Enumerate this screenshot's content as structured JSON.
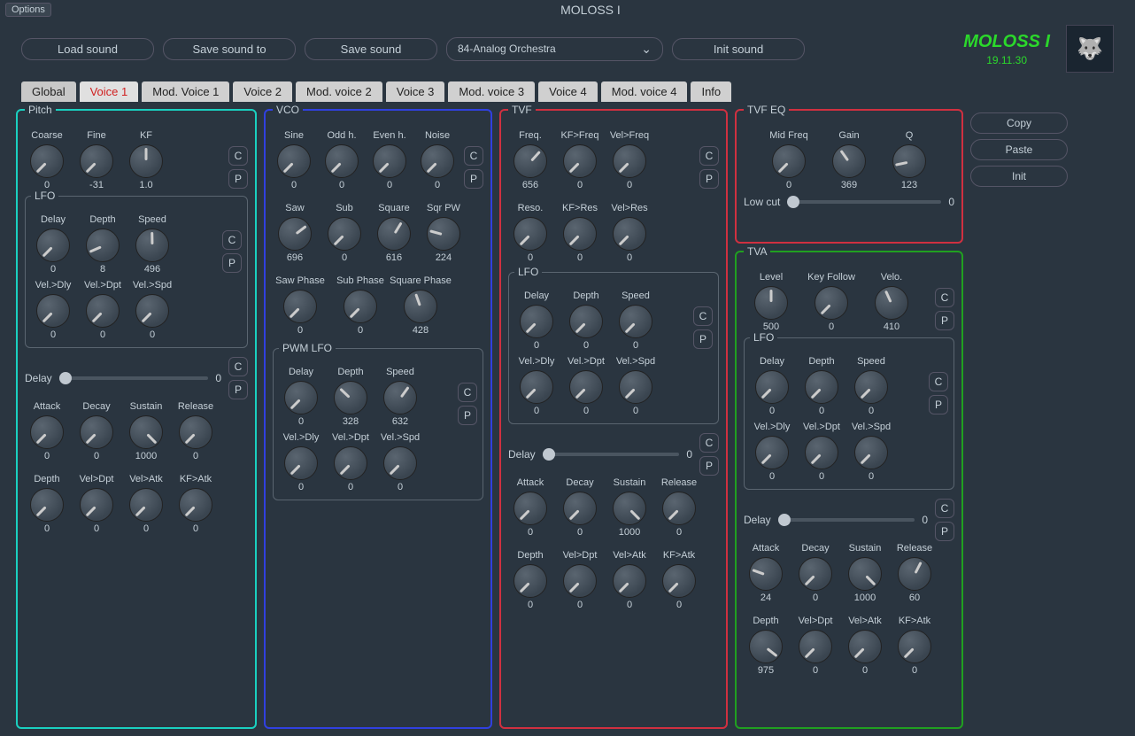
{
  "window": {
    "options": "Options",
    "title": "MOLOSS I"
  },
  "toolbar": {
    "load": "Load sound",
    "saveto": "Save sound to",
    "save": "Save sound",
    "preset": "84-Analog Orchestra",
    "init": "Init sound"
  },
  "brand": {
    "name": "MOLOSS I",
    "version": "19.11.30"
  },
  "tabs": [
    "Global",
    "Voice 1",
    "Mod. Voice 1",
    "Voice 2",
    "Mod. voice 2",
    "Voice 3",
    "Mod. voice 3",
    "Voice 4",
    "Mod. voice 4",
    "Info"
  ],
  "active_tab": 1,
  "side": {
    "copy": "Copy",
    "paste": "Paste",
    "init": "Init"
  },
  "cp": {
    "c": "C",
    "p": "P"
  },
  "pitch": {
    "title": "Pitch",
    "top": [
      {
        "l": "Coarse",
        "v": "0"
      },
      {
        "l": "Fine",
        "v": "-31"
      },
      {
        "l": "KF",
        "v": "1.0"
      }
    ],
    "lfo_title": "LFO",
    "lfo1": [
      {
        "l": "Delay",
        "v": "0"
      },
      {
        "l": "Depth",
        "v": "8"
      },
      {
        "l": "Speed",
        "v": "496"
      }
    ],
    "lfo2": [
      {
        "l": "Vel.>Dly",
        "v": "0"
      },
      {
        "l": "Vel.>Dpt",
        "v": "0"
      },
      {
        "l": "Vel.>Spd",
        "v": "0"
      }
    ],
    "delay_label": "Delay",
    "delay_val": "0",
    "adsr": [
      {
        "l": "Attack",
        "v": "0"
      },
      {
        "l": "Decay",
        "v": "0"
      },
      {
        "l": "Sustain",
        "v": "1000"
      },
      {
        "l": "Release",
        "v": "0"
      }
    ],
    "depth": [
      {
        "l": "Depth",
        "v": "0"
      },
      {
        "l": "Vel>Dpt",
        "v": "0"
      },
      {
        "l": "Vel>Atk",
        "v": "0"
      },
      {
        "l": "KF>Atk",
        "v": "0"
      }
    ]
  },
  "vco": {
    "title": "VCO",
    "r1": [
      {
        "l": "Sine",
        "v": "0"
      },
      {
        "l": "Odd h.",
        "v": "0"
      },
      {
        "l": "Even h.",
        "v": "0"
      },
      {
        "l": "Noise",
        "v": "0"
      }
    ],
    "r2": [
      {
        "l": "Saw",
        "v": "696"
      },
      {
        "l": "Sub",
        "v": "0"
      },
      {
        "l": "Square",
        "v": "616"
      },
      {
        "l": "Sqr PW",
        "v": "224"
      }
    ],
    "r3": [
      {
        "l": "Saw Phase",
        "v": "0"
      },
      {
        "l": "Sub Phase",
        "v": "0"
      },
      {
        "l": "Square Phase",
        "v": "428"
      }
    ],
    "pwm_title": "PWM LFO",
    "pwm1": [
      {
        "l": "Delay",
        "v": "0"
      },
      {
        "l": "Depth",
        "v": "328"
      },
      {
        "l": "Speed",
        "v": "632"
      }
    ],
    "pwm2": [
      {
        "l": "Vel.>Dly",
        "v": "0"
      },
      {
        "l": "Vel.>Dpt",
        "v": "0"
      },
      {
        "l": "Vel.>Spd",
        "v": "0"
      }
    ]
  },
  "tvf": {
    "title": "TVF",
    "r1": [
      {
        "l": "Freq.",
        "v": "656"
      },
      {
        "l": "KF>Freq",
        "v": "0"
      },
      {
        "l": "Vel>Freq",
        "v": "0"
      }
    ],
    "r2": [
      {
        "l": "Reso.",
        "v": "0"
      },
      {
        "l": "KF>Res",
        "v": "0"
      },
      {
        "l": "Vel>Res",
        "v": "0"
      }
    ],
    "lfo_title": "LFO",
    "lfo1": [
      {
        "l": "Delay",
        "v": "0"
      },
      {
        "l": "Depth",
        "v": "0"
      },
      {
        "l": "Speed",
        "v": "0"
      }
    ],
    "lfo2": [
      {
        "l": "Vel.>Dly",
        "v": "0"
      },
      {
        "l": "Vel.>Dpt",
        "v": "0"
      },
      {
        "l": "Vel.>Spd",
        "v": "0"
      }
    ],
    "delay_label": "Delay",
    "delay_val": "0",
    "adsr": [
      {
        "l": "Attack",
        "v": "0"
      },
      {
        "l": "Decay",
        "v": "0"
      },
      {
        "l": "Sustain",
        "v": "1000"
      },
      {
        "l": "Release",
        "v": "0"
      }
    ],
    "depth": [
      {
        "l": "Depth",
        "v": "0"
      },
      {
        "l": "Vel>Dpt",
        "v": "0"
      },
      {
        "l": "Vel>Atk",
        "v": "0"
      },
      {
        "l": "KF>Atk",
        "v": "0"
      }
    ]
  },
  "eq": {
    "title": "TVF EQ",
    "r": [
      {
        "l": "Mid Freq",
        "v": "0"
      },
      {
        "l": "Gain",
        "v": "369"
      },
      {
        "l": "Q",
        "v": "123"
      }
    ],
    "lowcut_label": "Low cut",
    "lowcut_val": "0"
  },
  "tva": {
    "title": "TVA",
    "top": [
      {
        "l": "Level",
        "v": "500"
      },
      {
        "l": "Key Follow",
        "v": "0"
      },
      {
        "l": "Velo.",
        "v": "410"
      }
    ],
    "lfo_title": "LFO",
    "lfo1": [
      {
        "l": "Delay",
        "v": "0"
      },
      {
        "l": "Depth",
        "v": "0"
      },
      {
        "l": "Speed",
        "v": "0"
      }
    ],
    "lfo2": [
      {
        "l": "Vel.>Dly",
        "v": "0"
      },
      {
        "l": "Vel.>Dpt",
        "v": "0"
      },
      {
        "l": "Vel.>Spd",
        "v": "0"
      }
    ],
    "delay_label": "Delay",
    "delay_val": "0",
    "adsr": [
      {
        "l": "Attack",
        "v": "24"
      },
      {
        "l": "Decay",
        "v": "0"
      },
      {
        "l": "Sustain",
        "v": "1000"
      },
      {
        "l": "Release",
        "v": "60"
      }
    ],
    "depth": [
      {
        "l": "Depth",
        "v": "975"
      },
      {
        "l": "Vel>Dpt",
        "v": "0"
      },
      {
        "l": "Vel>Atk",
        "v": "0"
      },
      {
        "l": "KF>Atk",
        "v": "0"
      }
    ]
  }
}
